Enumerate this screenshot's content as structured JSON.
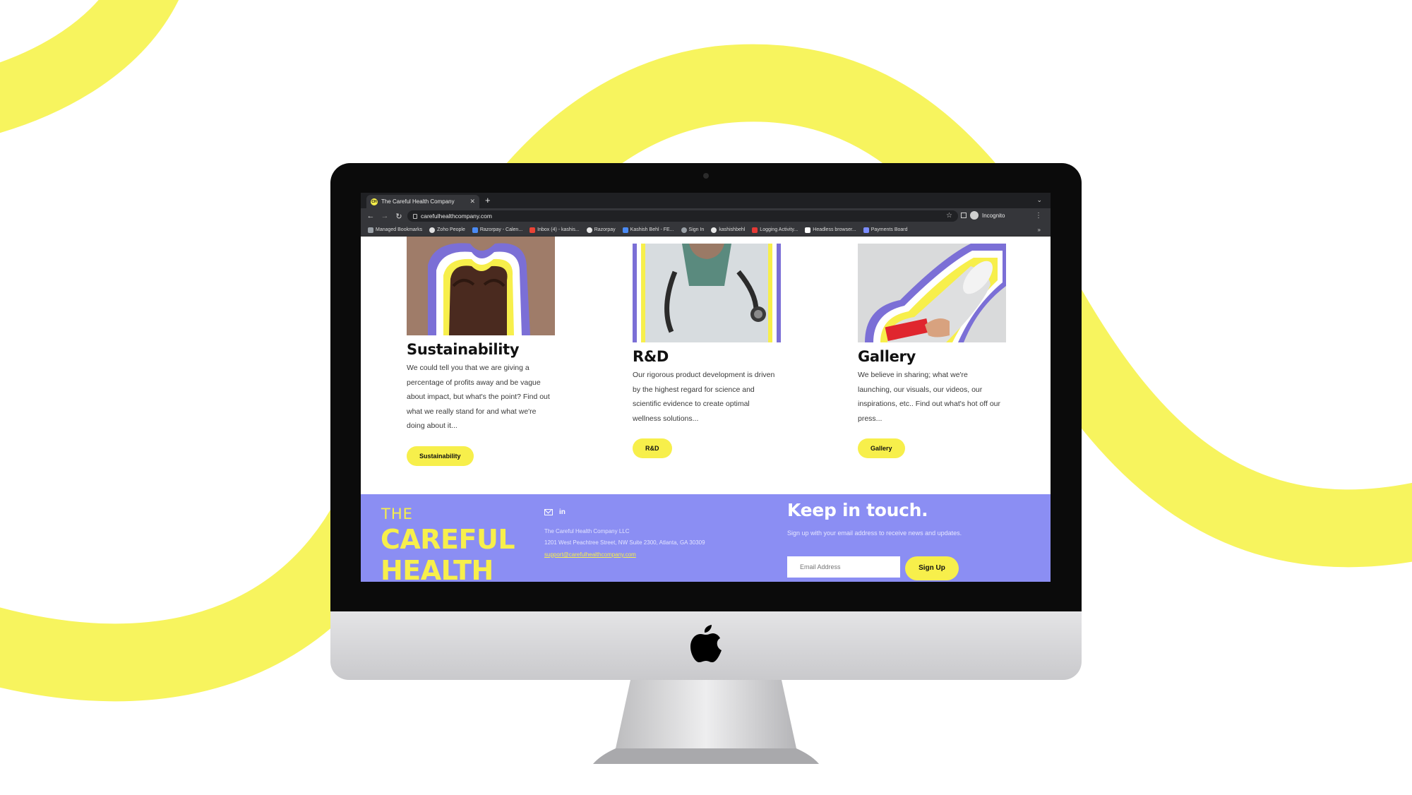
{
  "colors": {
    "accent_yellow": "#f7ef4b",
    "footer_purple": "#8b8ef3",
    "chrome_dark": "#35363a"
  },
  "browser": {
    "tab_title": "The Careful Health Company",
    "tab_favicon_text": "CH",
    "url": "carefulhealthcompany.com",
    "incognito_label": "Incognito",
    "bookmarks": [
      {
        "label": "Managed Bookmarks",
        "icon": "folder-icon"
      },
      {
        "label": "Zoho People",
        "icon": "zoho-icon"
      },
      {
        "label": "Razorpay - Calen...",
        "icon": "calendar-icon"
      },
      {
        "label": "Inbox (4) - kashis...",
        "icon": "gmail-icon"
      },
      {
        "label": "Razorpay",
        "icon": "github-icon"
      },
      {
        "label": "Kashish Behl - FE...",
        "icon": "doc-icon"
      },
      {
        "label": "Sign In",
        "icon": "globe-icon"
      },
      {
        "label": "kashishbehl",
        "icon": "github-icon"
      },
      {
        "label": "Logging Activity...",
        "icon": "s-icon"
      },
      {
        "label": "Headless browser...",
        "icon": "headless-icon"
      },
      {
        "label": "Payments Board",
        "icon": "board-icon"
      }
    ]
  },
  "cards": [
    {
      "title": "Sustainability",
      "body": "We could tell you that we are giving a percentage of profits away and be vague about impact, but what's the point? Find out what we really stand for and what we're doing about it...",
      "button": "Sustainability",
      "image": "raised-fists-image"
    },
    {
      "title": "R&D",
      "body": "Our rigorous product development is driven by the highest regard for science and scientific evidence to create optimal wellness solutions...",
      "button": "R&D",
      "image": "doctor-stethoscope-image"
    },
    {
      "title": "Gallery",
      "body": "We believe in sharing; what we're launching, our visuals, our videos, our inspirations, etc.. Find out what's hot off our press...",
      "button": "Gallery",
      "image": "megaphone-image"
    }
  ],
  "footer": {
    "brand_the": "THE",
    "brand_careful": "CAREFUL",
    "brand_health": "HEALTH",
    "company": "The Careful Health Company LLC",
    "address": "1201 West Peachtree Street, NW Suite 2300, Atlanta, GA 30309",
    "email": "support@carefulhealthcompany.com",
    "newsletter_title": "Keep in touch.",
    "newsletter_sub": "Sign up with your email address to receive news and updates.",
    "email_placeholder": "Email Address",
    "signup_label": "Sign Up"
  }
}
